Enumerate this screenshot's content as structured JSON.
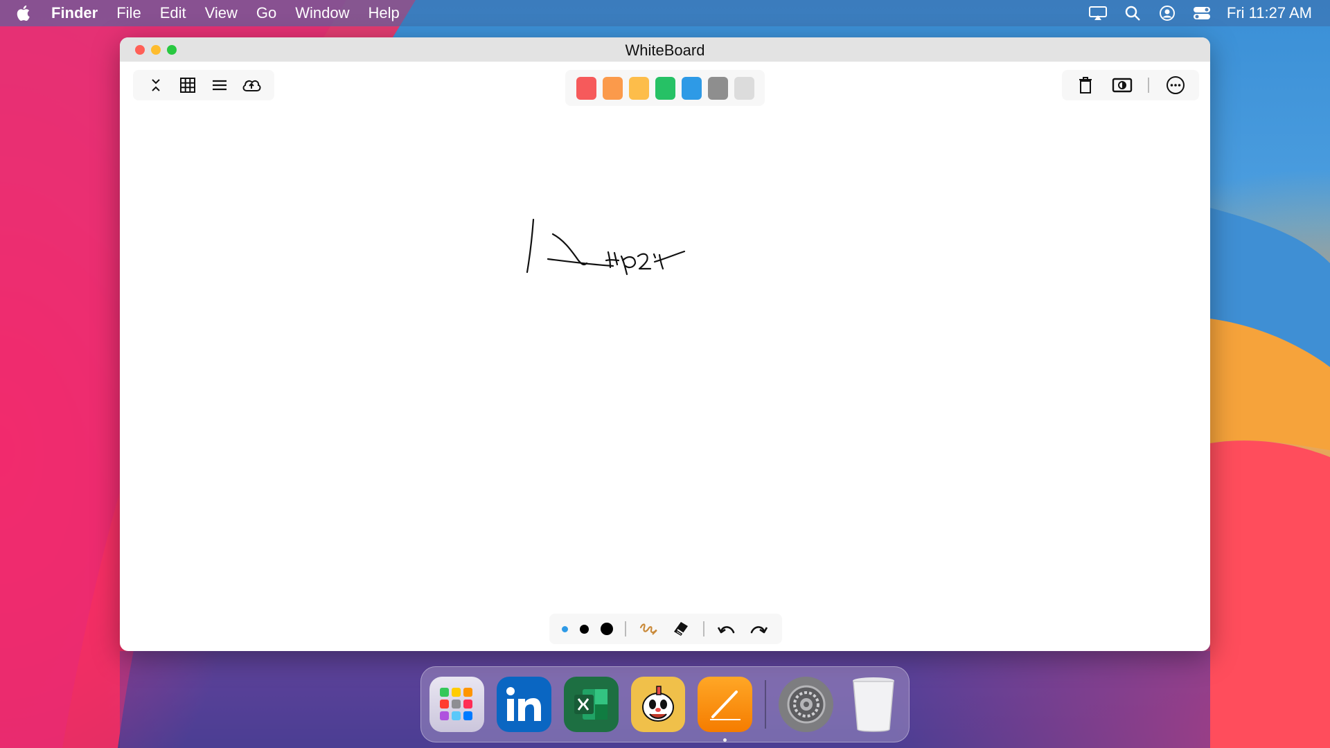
{
  "menubar": {
    "app_name": "Finder",
    "items": [
      "File",
      "Edit",
      "View",
      "Go",
      "Window",
      "Help"
    ],
    "clock": "Fri 11:27 AM",
    "status_icons": [
      "airplay-icon",
      "search-icon",
      "user-icon",
      "control-center-icon"
    ]
  },
  "window": {
    "title": "WhiteBoard",
    "toolbar_left": [
      "collapse-icon",
      "grid-icon",
      "menu-icon",
      "cloud-upload-icon"
    ],
    "palette": [
      "#f65a5b",
      "#fb9a4b",
      "#fdbd4a",
      "#26c165",
      "#2e9ae6",
      "#8e8e8e",
      "#dcdcdc"
    ],
    "toolbar_right": [
      "trash-icon",
      "dark-mode-toggle-icon",
      "more-icon"
    ],
    "bottom_tools": [
      "brush-small",
      "brush-medium",
      "brush-large",
      "pen-icon",
      "eraser-icon",
      "undo-icon",
      "redo-icon"
    ],
    "brush_small_color": "#2e9ae6"
  },
  "dock": {
    "apps": [
      "Launchpad",
      "LinkedIn",
      "Excel",
      "Cuphead",
      "Pages",
      "System Preferences",
      "Trash"
    ]
  }
}
